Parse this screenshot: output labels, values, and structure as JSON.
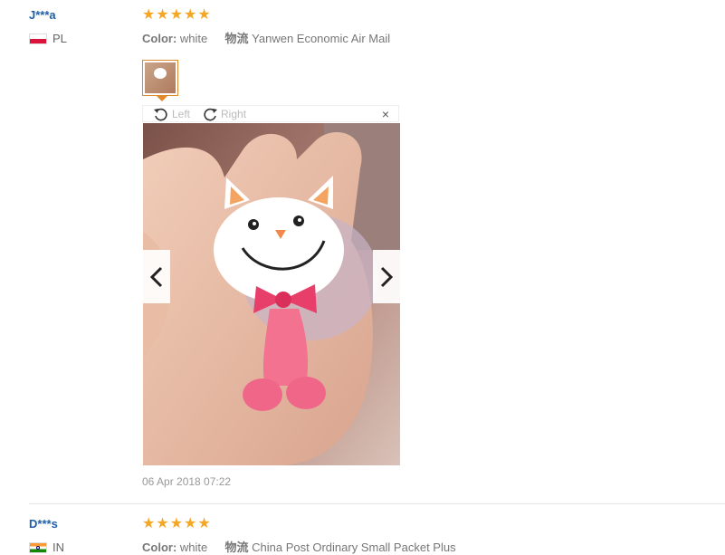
{
  "reviews": [
    {
      "user": "J***a",
      "country": "PL",
      "rating": 5,
      "color_label": "Color:",
      "color_value": "white",
      "shipping_label": "物流",
      "shipping_value": "Yanwen Economic Air Mail",
      "rotate_left_label": "Left",
      "rotate_right_label": "Right",
      "close_label": "×",
      "date": "06 Apr 2018 07:22"
    },
    {
      "user": "D***s",
      "country": "IN",
      "rating": 5,
      "color_label": "Color:",
      "color_value": "white",
      "shipping_label": "物流",
      "shipping_value": "China Post Ordinary Small Packet Plus"
    }
  ],
  "colors": {
    "star": "#f5a623",
    "user": "#1e5fa8",
    "thumb_border": "#e08a2c"
  },
  "icons": [
    "rotate-left-icon",
    "rotate-right-icon",
    "close-icon",
    "chevron-left-icon",
    "chevron-right-icon",
    "star-icon"
  ]
}
